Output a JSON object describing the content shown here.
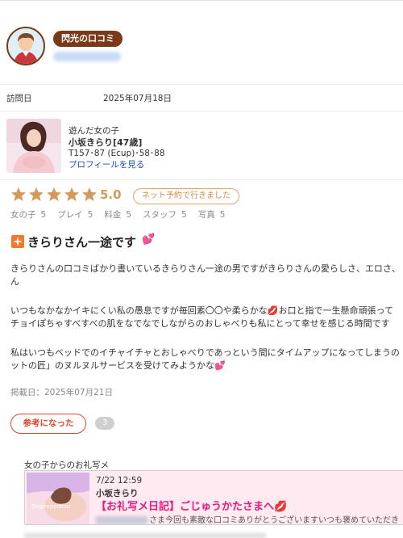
{
  "reviewer": {
    "badge": "閃光の口コミ"
  },
  "visit": {
    "label": "訪問日",
    "date": "2025年07月18日"
  },
  "girl": {
    "label": "遊んだ女の子",
    "name": "小坂きらり[47歳]",
    "spec": "T157･87 (Ecup)･58･88",
    "profile_link": "プロフィールを見る"
  },
  "rating": {
    "stars": 5,
    "score": "5.0",
    "reserve_badge": "ネット予約で行きました",
    "categories": [
      {
        "label": "女の子",
        "value": "5"
      },
      {
        "label": "プレイ",
        "value": "5"
      },
      {
        "label": "料金",
        "value": "5"
      },
      {
        "label": "スタッフ",
        "value": "5"
      },
      {
        "label": "写真",
        "value": "5"
      }
    ]
  },
  "review": {
    "title": "きらりさん一途です",
    "body_lines": [
      "きらりさんの口コミばかり書いているきらりさん一途の男ですがきらりさんの愛らしさ、エロさ、",
      "ん",
      "いつもなかなかイキにくい私の愚息ですが毎回素〇〇や柔らかな",
      "お口と指で一生懸命頑張って",
      "チョイぽちゃすべすべの肌をなでなでしながらのおしゃべりも私にとって幸せを感じる時間です",
      "私はいつもベッドでのイチャイチャとおしゃべりであっという間にタイムアップになってしまうの",
      "ットの匠」のヌルヌルサービスを受けてみようかな"
    ],
    "posted": "掲載日：2025年07月21日"
  },
  "helpful": {
    "button_label": "参考になった",
    "count": "3"
  },
  "thanks": {
    "section_label": "女の子からのお礼写メ",
    "time": "7/22 12:59",
    "name": "小坂きらり",
    "title": "【お礼写メ日記】ごじゅうかたさまへ",
    "excerpt": "さま今回も素敵な口コミありがとうございますいつも褒めていただき"
  },
  "colors": {
    "badge_bg": "#7a3a1a",
    "star": "#d59a5b",
    "link": "#1a4fc4",
    "accent_pink": "#e8197a",
    "helpful_red": "#d9482f"
  },
  "icons": {
    "title_icon": "sparkle-icon",
    "heart": "heart-icon",
    "lips": "lips-icon"
  }
}
